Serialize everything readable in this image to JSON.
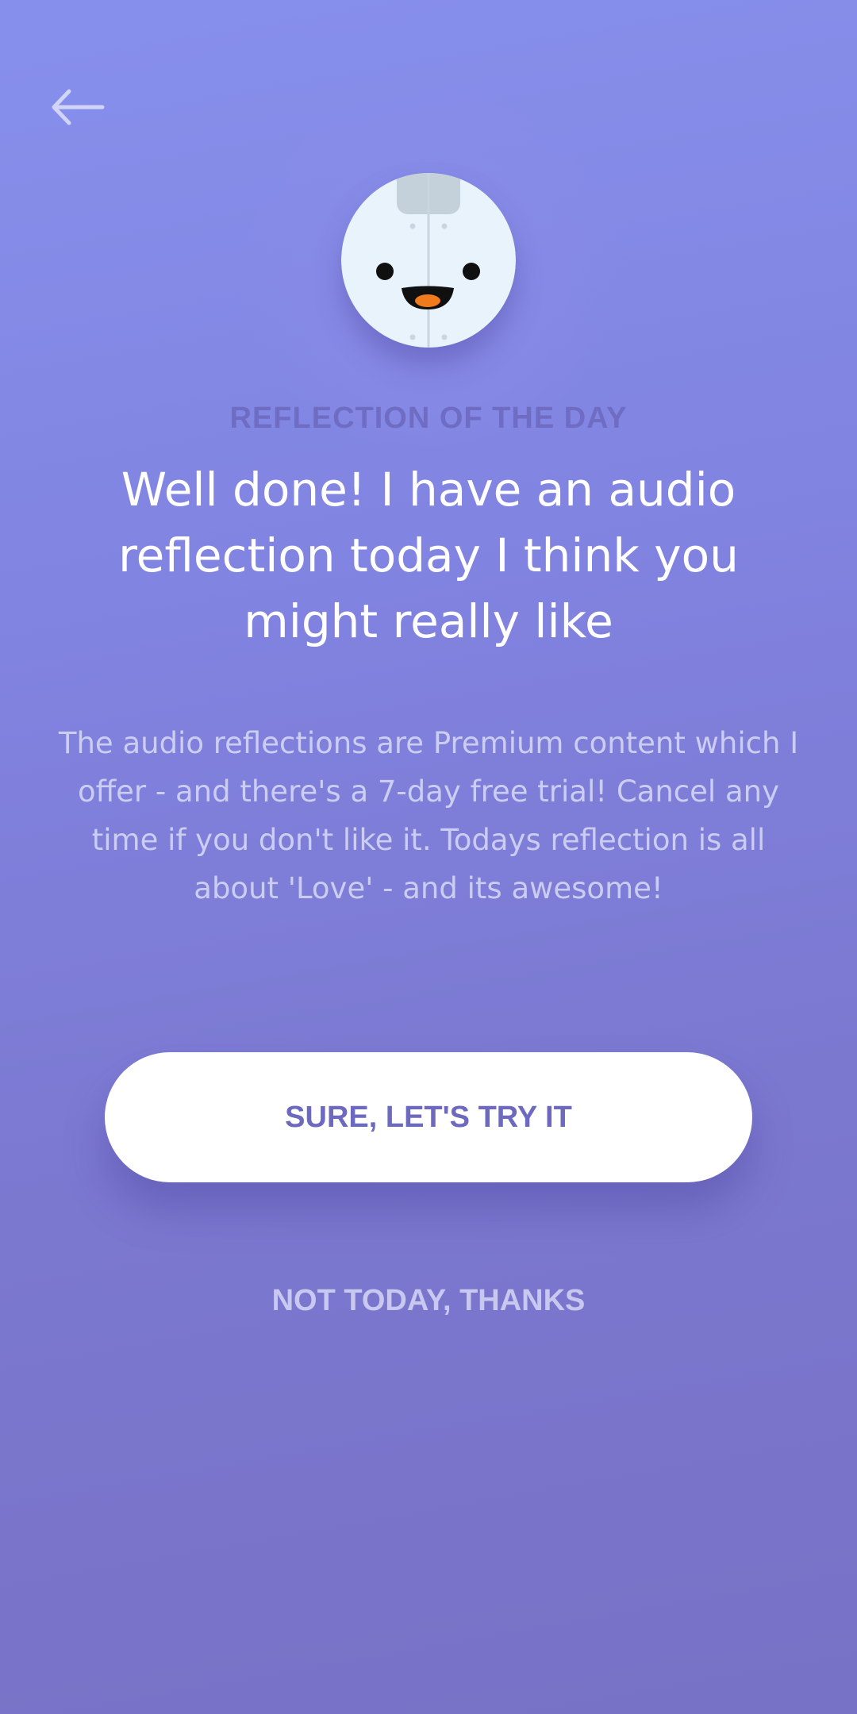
{
  "nav": {
    "back_icon": "arrow-left-icon"
  },
  "mascot": {
    "icon": "smiling-mascot-avatar"
  },
  "content": {
    "eyebrow": "REFLECTION OF THE DAY",
    "headline": "Well done! I have an audio reflection today I think you might really like",
    "body": "The audio reflections are Premium content which I offer - and there's a 7-day free trial! Cancel any time if you don't like it. Todays reflection is all about 'Love' - and its awesome!"
  },
  "actions": {
    "primary_label": "SURE, LET'S TRY IT",
    "secondary_label": "NOT TODAY, THANKS"
  },
  "colors": {
    "background_top": "#8690ec",
    "background_bottom": "#7872c6",
    "accent_text": "#6d69bf",
    "button_background": "#ffffff"
  }
}
